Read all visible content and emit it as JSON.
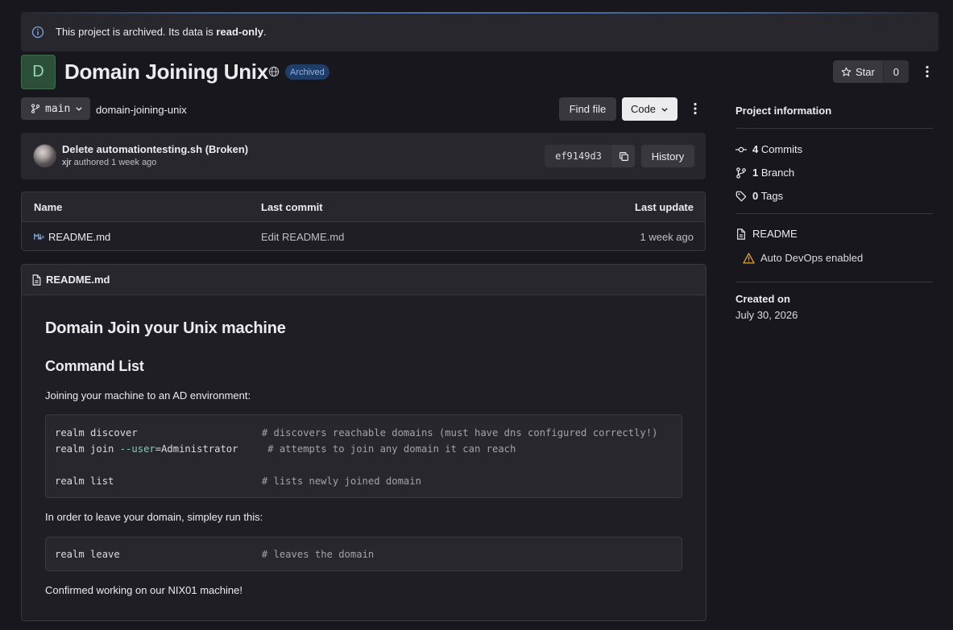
{
  "alert": {
    "text_prefix": "This project is archived. Its data is ",
    "text_bold": "read-only",
    "text_suffix": "."
  },
  "project": {
    "avatar_letter": "D",
    "title": "Domain Joining Unix",
    "badge": "Archived",
    "star_label": "Star",
    "star_count": "0"
  },
  "repo": {
    "branch": "main",
    "path": "domain-joining-unix",
    "find_file": "Find file",
    "code": "Code"
  },
  "commit": {
    "title": "Delete automationtesting.sh (Broken)",
    "author": "xjr",
    "meta": "authored 1 week ago",
    "sha": "ef9149d3",
    "history": "History"
  },
  "files": {
    "headers": {
      "name": "Name",
      "last_commit": "Last commit",
      "last_update": "Last update"
    },
    "rows": [
      {
        "name": "README.md",
        "last_commit": "Edit README.md",
        "last_update": "1 week ago"
      }
    ]
  },
  "readme": {
    "filename": "README.md",
    "h1": "Domain Join your Unix machine",
    "h2": "Command List",
    "p1": "Joining your machine to an AD environment:",
    "code1": {
      "l1_cmd": "realm discover",
      "l1_comment": "# discovers reachable domains (must have dns configured correctly!)",
      "l2_cmd_a": "realm join ",
      "l2_flag": "--user",
      "l2_cmd_b": "=Administrator",
      "l2_comment": "# attempts to join any domain it can reach",
      "l3_cmd": "realm list",
      "l3_comment": "# lists newly joined domain"
    },
    "p2": "In order to leave your domain, simpley run this:",
    "code2": {
      "l1_cmd": "realm leave",
      "l1_comment": "# leaves the domain"
    },
    "p3": "Confirmed working on our NIX01 machine!"
  },
  "sidebar": {
    "title": "Project information",
    "commits_count": "4",
    "commits_label": "Commits",
    "branch_count": "1",
    "branch_label": "Branch",
    "tags_count": "0",
    "tags_label": "Tags",
    "readme_label": "README",
    "autodevops_label": "Auto DevOps enabled",
    "created_label": "Created on",
    "created_value": "July 30, 2026"
  },
  "colors": {
    "background": "#18171d",
    "panel": "#28272d",
    "badge_bg": "#1f3d66",
    "warning": "#e2a33a"
  },
  "icons": [
    "info-icon",
    "globe-icon",
    "star-icon",
    "kebab-icon",
    "branch-icon",
    "chevron-down-icon",
    "copy-icon",
    "markdown-icon",
    "file-icon",
    "commit-icon",
    "tag-icon",
    "warning-icon"
  ]
}
